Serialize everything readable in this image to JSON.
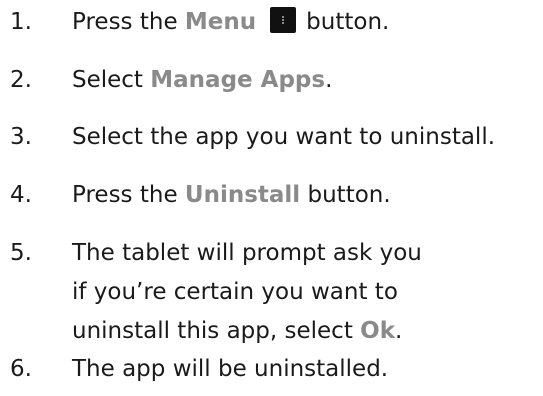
{
  "steps": [
    {
      "number": "1.",
      "before": "Press the ",
      "highlight": "Menu",
      "icon": "menu-icon",
      "after": "button."
    },
    {
      "number": "2.",
      "before": "Select ",
      "highlight": "Manage Apps",
      "after": "."
    },
    {
      "number": "3.",
      "text": "Select the app you want to uninstall."
    },
    {
      "number": "4.",
      "before": "Press the ",
      "highlight": "Uninstall",
      "after": " button."
    },
    {
      "number": "5.",
      "line1": "The tablet will prompt ask you",
      "line2": "if you’re certain you want to",
      "line3_before": "uninstall this app, select ",
      "highlight": "Ok",
      "line3_after": "."
    },
    {
      "number": "6.",
      "text": "The app will be uninstalled."
    }
  ],
  "colors": {
    "text": "#1a1a1a",
    "highlight": "#8a8a8a",
    "icon_bg": "#111111"
  }
}
